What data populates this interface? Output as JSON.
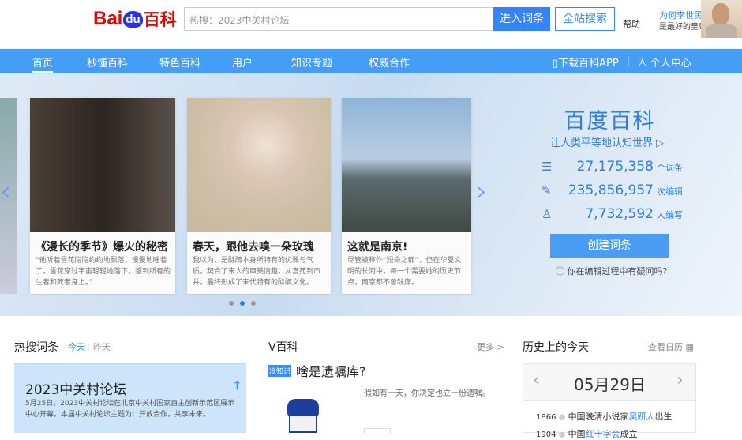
{
  "header": {
    "logo": {
      "bai": "Bai",
      "du": "du",
      "baike": "百科"
    },
    "search_placeholder": "热搜：2023中关村论坛",
    "enter_button": "进入词条",
    "site_search_button": "全站搜索",
    "help": "帮助",
    "promo_line1": "为何李世民",
    "promo_line2": "是最好的皇帝?"
  },
  "nav": {
    "items": [
      "首页",
      "秒懂百科",
      "特色百科",
      "用户",
      "知识专题",
      "权威合作"
    ],
    "download_app": "下载百科APP",
    "personal_center": "个人中心"
  },
  "carousel": {
    "cards": [
      {
        "title": "《漫长的季节》爆火的秘密",
        "desc": "“他听着雪花隐隐约约地飘落，慢慢地睡着了，雪花穿过宇宙轻轻地落下，落到所有的生者和死者身上。”"
      },
      {
        "title": "春天，跟他去嗅一朵玫瑰",
        "desc": "我以为，是酴醾本身所特有的优雅与气质，契合了宋人的审美情趣，从宫苑到市井，最终形成了宋代特有的酴醾文化。"
      },
      {
        "title": "这就是南京!",
        "desc": "尽管被称作“短命之都”，但在华夏文明的长河中，每一个需要她的历史节点，南京都不曾缺席。"
      }
    ],
    "active_dot": 1,
    "dot_count": 3
  },
  "baike": {
    "title": "百度百科",
    "slogan": "让人类平等地认知世界",
    "stats": [
      {
        "value": "27,175,358",
        "unit": "个词条"
      },
      {
        "value": "235,856,957",
        "unit": "次编辑"
      },
      {
        "value": "7,732,592",
        "unit": "人编写"
      }
    ],
    "create_button": "创建词条",
    "help_question": "你在编辑过程中有疑问吗?"
  },
  "hot": {
    "title": "热搜词条",
    "tab_today": "今天",
    "tab_yesterday": "昨天",
    "card_title": "2023中关村论坛",
    "card_desc": "5月25日，2023中关村论坛在北京中关村国家自主创新示范区展示中心开幕。本届中关村论坛主题为：开放合作，共享未来。"
  },
  "vbaike": {
    "title": "V百科",
    "more": "更多 >",
    "tag": "冷知识",
    "headline": "啥是遗嘱库?",
    "desc": "假如有一天，你决定也立一份遗嘱。"
  },
  "history": {
    "title": "历史上的今天",
    "calendar_link": "查看日历",
    "date": "05月29日",
    "events": [
      {
        "year": "1866",
        "pre": "中国晚清小说家",
        "link": "吴趼人",
        "post": "出生"
      },
      {
        "year": "1904",
        "pre": "中国",
        "link": "红十字会",
        "post": "成立"
      }
    ]
  }
}
